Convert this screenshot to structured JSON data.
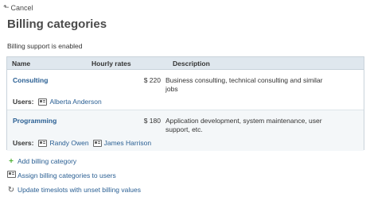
{
  "nav": {
    "cancel_label": "Cancel"
  },
  "page": {
    "title": "Billing categories",
    "status_text": "Billing support is enabled"
  },
  "table": {
    "headers": {
      "name": "Name",
      "rates": "Hourly rates",
      "description": "Description"
    },
    "users_label": "Users:",
    "rows": [
      {
        "name": "Consulting",
        "rate": "$ 220",
        "description": "Business consulting, technical consulting and similar jobs",
        "users": [
          "Alberta Anderson"
        ]
      },
      {
        "name": "Programming",
        "rate": "$ 180",
        "description": "Application development, system maintenance, user support, etc.",
        "users": [
          "Randy Owen",
          "James Harrison"
        ]
      }
    ]
  },
  "actions": {
    "add": "Add billing category",
    "assign": "Assign billing categories to users",
    "update": "Update timeslots with unset billing values"
  },
  "colors": {
    "link": "#2a5f93",
    "header_bg": "#dfe7ee",
    "plus": "#4caf32"
  }
}
